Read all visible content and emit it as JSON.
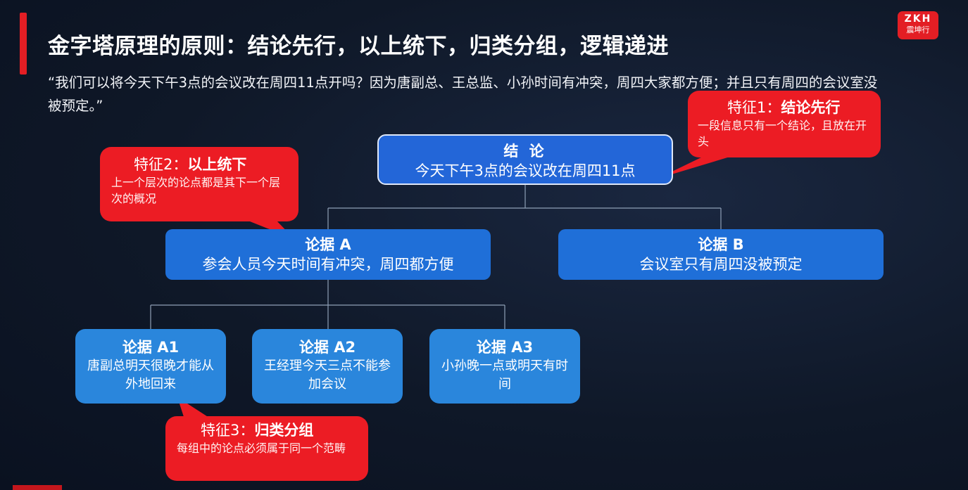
{
  "title": "金字塔原理的原则：结论先行，以上统下，归类分组，逻辑递进",
  "quote": "“我们可以将今天下午3点的会议改在周四11点开吗？因为唐副总、王总监、小孙时间有冲突，周四大家都方便；并且只有周四的会议室没被预定。”",
  "logo": {
    "line1": "ZKH",
    "line2": "震坤行"
  },
  "colors": {
    "accent": "#e31e24",
    "node_root": "#2366d8",
    "node_level2": "#1f6fd8",
    "node_level3": "#2a86dc",
    "callout": "#ec1c24"
  },
  "tree": {
    "root": {
      "heading": "结 论",
      "text": "今天下午3点的会议改在周四11点"
    },
    "a": {
      "heading": "论据 A",
      "text": "参会人员今天时间有冲突，周四都方便"
    },
    "b": {
      "heading": "论据 B",
      "text": "会议室只有周四没被预定"
    },
    "a1": {
      "heading": "论据 A1",
      "text": "唐副总明天很晚才能从外地回来"
    },
    "a2": {
      "heading": "论据 A2",
      "text": "王经理今天三点不能参加会议"
    },
    "a3": {
      "heading": "论据 A3",
      "text": "小孙晚一点或明天有时间"
    }
  },
  "callouts": {
    "c1": {
      "label": "特征1：",
      "name": "结论先行",
      "text": "一段信息只有一个结论，且放在开头"
    },
    "c2": {
      "label": "特征2：",
      "name": "以上统下",
      "text": "上一个层次的论点都是其下一个层次的概况"
    },
    "c3": {
      "label": "特征3：",
      "name": "归类分组",
      "text": "每组中的论点必须属于同一个范畴"
    }
  }
}
